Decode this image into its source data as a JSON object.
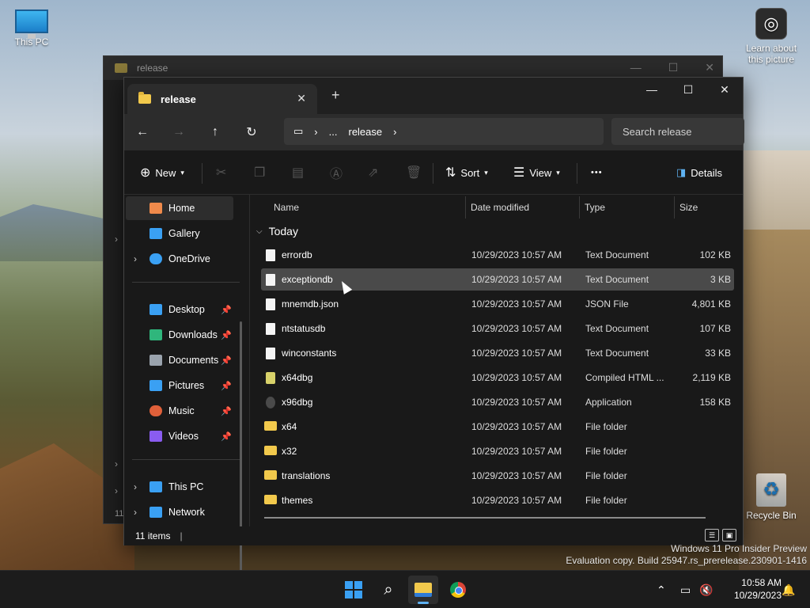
{
  "desktop": {
    "icons": [
      {
        "label": "This PC"
      },
      {
        "label": "Learn about this picture"
      },
      {
        "label": "Recycle Bin"
      }
    ],
    "watermark": {
      "line1": "Windows 11 Pro Insider Preview",
      "line2": "Evaluation copy. Build 25947.rs_prerelease.230901-1416"
    }
  },
  "background_window": {
    "tab_title": "release",
    "status_count": "11"
  },
  "window": {
    "tab_title": "release",
    "address": {
      "path": [
        "...",
        "release"
      ]
    },
    "search_placeholder": "Search release",
    "toolbar": {
      "new_label": "New",
      "sort_label": "Sort",
      "view_label": "View",
      "more_label": "•••",
      "details_label": "Details"
    },
    "sidebar": {
      "items": [
        {
          "label": "Home",
          "icon": "home-icon",
          "color": "#f08a4b"
        },
        {
          "label": "Gallery",
          "icon": "gallery-icon",
          "color": "#3aa0f3"
        },
        {
          "label": "OneDrive",
          "icon": "onedrive-icon",
          "color": "#3aa0f3"
        },
        {
          "label": "Desktop",
          "icon": "desktop-icon",
          "color": "#3aa0f3"
        },
        {
          "label": "Downloads",
          "icon": "downloads-icon",
          "color": "#2fb67c"
        },
        {
          "label": "Documents",
          "icon": "documents-icon",
          "color": "#9aa3ad"
        },
        {
          "label": "Pictures",
          "icon": "pictures-icon",
          "color": "#3aa0f3"
        },
        {
          "label": "Music",
          "icon": "music-icon",
          "color": "#e0603a"
        },
        {
          "label": "Videos",
          "icon": "videos-icon",
          "color": "#8a5cf0"
        },
        {
          "label": "This PC",
          "icon": "this-pc-icon",
          "color": "#3aa0f3"
        },
        {
          "label": "Network",
          "icon": "network-icon",
          "color": "#3aa0f3"
        }
      ]
    },
    "columns": {
      "name": "Name",
      "date": "Date modified",
      "type": "Type",
      "size": "Size"
    },
    "group_label": "Today",
    "files": [
      {
        "name": "errordb",
        "date": "10/29/2023 10:57 AM",
        "type": "Text Document",
        "size": "102 KB",
        "kind": "doc"
      },
      {
        "name": "exceptiondb",
        "date": "10/29/2023 10:57 AM",
        "type": "Text Document",
        "size": "3 KB",
        "kind": "doc"
      },
      {
        "name": "mnemdb.json",
        "date": "10/29/2023 10:57 AM",
        "type": "JSON File",
        "size": "4,801 KB",
        "kind": "doc"
      },
      {
        "name": "ntstatusdb",
        "date": "10/29/2023 10:57 AM",
        "type": "Text Document",
        "size": "107 KB",
        "kind": "doc"
      },
      {
        "name": "winconstants",
        "date": "10/29/2023 10:57 AM",
        "type": "Text Document",
        "size": "33 KB",
        "kind": "doc"
      },
      {
        "name": "x64dbg",
        "date": "10/29/2023 10:57 AM",
        "type": "Compiled HTML ...",
        "size": "2,119 KB",
        "kind": "chm"
      },
      {
        "name": "x96dbg",
        "date": "10/29/2023 10:57 AM",
        "type": "Application",
        "size": "158 KB",
        "kind": "app"
      },
      {
        "name": "x64",
        "date": "10/29/2023 10:57 AM",
        "type": "File folder",
        "size": "",
        "kind": "folder"
      },
      {
        "name": "x32",
        "date": "10/29/2023 10:57 AM",
        "type": "File folder",
        "size": "",
        "kind": "folder"
      },
      {
        "name": "translations",
        "date": "10/29/2023 10:57 AM",
        "type": "File folder",
        "size": "",
        "kind": "folder"
      },
      {
        "name": "themes",
        "date": "10/29/2023 10:57 AM",
        "type": "File folder",
        "size": "",
        "kind": "folder"
      }
    ],
    "status": {
      "count": "11 items",
      "divider": "|"
    }
  },
  "taskbar": {
    "time": "10:58 AM",
    "date": "10/29/2023",
    "accent": "#5fb2f2"
  }
}
